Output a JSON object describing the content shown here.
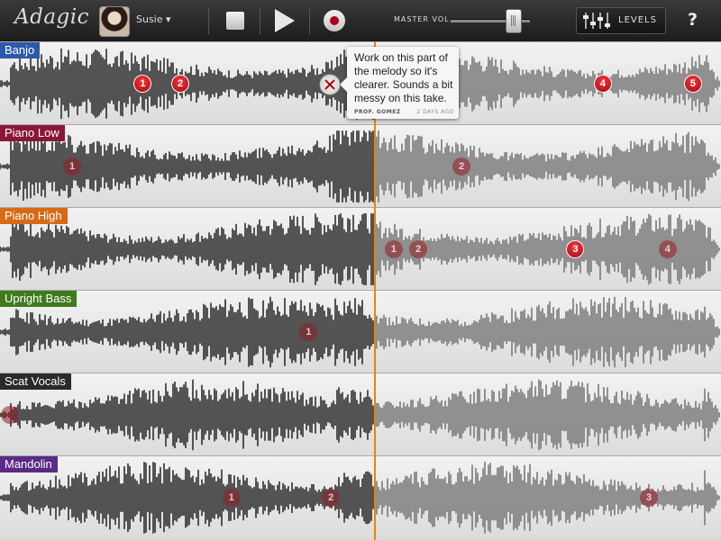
{
  "app": {
    "logo": "Adagic"
  },
  "user": {
    "name": "Susie ▾"
  },
  "transport": {
    "stop": "stop",
    "play": "play",
    "record": "record"
  },
  "master": {
    "label": "MASTER VOL",
    "volume": 0.78
  },
  "levels": {
    "label": "LEVELS"
  },
  "help": {
    "label": "?"
  },
  "playhead": {
    "position": 0.52
  },
  "colors": {
    "banjo": "#2c5aa8",
    "piano_low": "#8a1638",
    "piano_high": "#d86a16",
    "upright_bass": "#3f7a1e",
    "scat_vocals": "#2a2a2a",
    "mandolin": "#5a2a84",
    "playhead": "#e08a00",
    "marker": "#c8101e"
  },
  "tracks": [
    {
      "name": "Banjo",
      "color": "#2c5aa8",
      "markers": [
        {
          "n": "1",
          "pos": 0.198,
          "active": true
        },
        {
          "n": "2",
          "pos": 0.25,
          "active": true
        },
        {
          "n": "4",
          "pos": 0.836,
          "active": true
        },
        {
          "n": "5",
          "pos": 0.961,
          "active": true
        }
      ]
    },
    {
      "name": "Piano Low",
      "color": "#8a1638",
      "markers": [
        {
          "n": "1",
          "pos": 0.1,
          "active": false
        },
        {
          "n": "2",
          "pos": 0.64,
          "active": false
        }
      ]
    },
    {
      "name": "Piano High",
      "color": "#d86a16",
      "markers": [
        {
          "n": "1",
          "pos": 0.546,
          "active": false
        },
        {
          "n": "2",
          "pos": 0.58,
          "active": false
        },
        {
          "n": "3",
          "pos": 0.798,
          "active": true
        },
        {
          "n": "4",
          "pos": 0.926,
          "active": false
        }
      ]
    },
    {
      "name": "Upright Bass",
      "color": "#3f7a1e",
      "markers": [
        {
          "n": "1",
          "pos": 0.428,
          "active": false
        }
      ]
    },
    {
      "name": "Scat Vocals",
      "color": "#2a2a2a",
      "markers": [
        {
          "n": "",
          "pos": 0.014,
          "active": false
        }
      ]
    },
    {
      "name": "Mandolin",
      "color": "#5a2a84",
      "markers": [
        {
          "n": "1",
          "pos": 0.321,
          "active": false
        },
        {
          "n": "2",
          "pos": 0.459,
          "active": false
        },
        {
          "n": "3",
          "pos": 0.9,
          "active": false
        }
      ]
    }
  ],
  "comment": {
    "text": "Work on this part of the melody so it's clearer. Sounds a bit messy on this take.",
    "author": "PROF. GOMEZ",
    "time": "2 DAYS AGO"
  }
}
